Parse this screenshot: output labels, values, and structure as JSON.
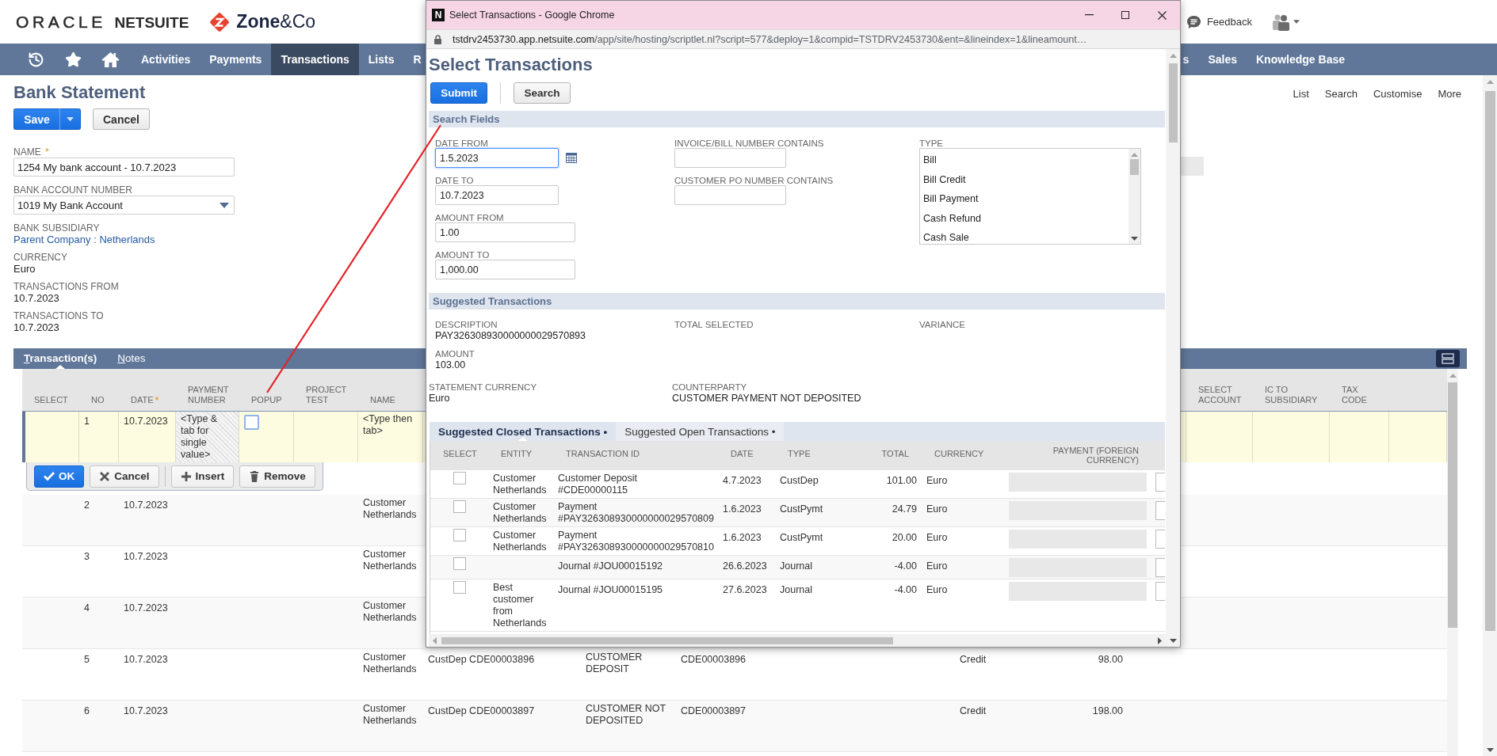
{
  "header": {
    "brand": "ORACLE **NETSUITE**",
    "partner": "**Zone**&Co",
    "feedback": "Feedback"
  },
  "nav": {
    "items": [
      {
        "label": "Activities",
        "selected": false
      },
      {
        "label": "Payments",
        "selected": false
      },
      {
        "label": "Transactions",
        "selected": true
      },
      {
        "label": "Lists",
        "selected": false
      },
      {
        "label": "R",
        "selected": false
      }
    ],
    "items_right": [
      {
        "label": "s",
        "selected": false
      },
      {
        "label": "Sales",
        "selected": false
      },
      {
        "label": "Knowledge Base",
        "selected": false
      }
    ]
  },
  "page": {
    "title": "Bank Statement",
    "actions": [
      "List",
      "Search",
      "Customise",
      "More"
    ],
    "save": "Save",
    "cancel": "Cancel"
  },
  "form": {
    "fields": [
      {
        "kind": "input",
        "label": "NAME",
        "mark": "*",
        "value": "1254 My bank account - 10.7.2023"
      },
      {
        "kind": "select",
        "label": "BANK ACCOUNT NUMBER",
        "value": "1019 My Bank Account"
      },
      {
        "kind": "link",
        "label": "BANK SUBSIDIARY",
        "value": "Parent Company : Netherlands"
      },
      {
        "kind": "text",
        "label": "CURRENCY",
        "value": "Euro"
      },
      {
        "kind": "text",
        "label": "TRANSACTIONS FROM",
        "value": "10.7.2023"
      },
      {
        "kind": "text",
        "label": "TRANSACTIONS TO",
        "value": "10.7.2023"
      }
    ],
    "side_field": {
      "disabled": true
    }
  },
  "tabs": [
    {
      "label": "Transaction(s)",
      "selected": true
    },
    {
      "label": "Notes",
      "selected": false
    }
  ],
  "table": {
    "columns": [
      {
        "label": "SELECT"
      },
      {
        "label": "NO"
      },
      {
        "label": "DATE",
        "mark": "*"
      },
      {
        "label": "PAYMENT NUMBER"
      },
      {
        "label": "POPUP"
      },
      {
        "label": "PROJECT TEST"
      },
      {
        "label": "NAME"
      }
    ],
    "columns_right": [
      {
        "label": "SELECT ACCOUNT"
      },
      {
        "label": "IC TO SUBSIDIARY"
      },
      {
        "label": "TAX CODE"
      }
    ],
    "edit_row": {
      "no": "1",
      "date": "10.7.2023",
      "payment_number": "<Type & tab for single value>",
      "popup": {
        "checked": false
      },
      "name": "<Type then tab>"
    },
    "edit_buttons": [
      {
        "kind": "ok",
        "label": "OK"
      },
      {
        "kind": "cancel",
        "label": "Cancel"
      },
      {
        "kind": "insert",
        "label": "Insert"
      },
      {
        "kind": "remove",
        "label": "Remove"
      }
    ],
    "rows": [
      {
        "no": "2",
        "date": "10.7.2023",
        "name": "Customer Netherlands"
      },
      {
        "no": "3",
        "date": "10.7.2023",
        "name": "Customer Netherlands"
      },
      {
        "no": "4",
        "date": "10.7.2023",
        "name": "Customer Netherlands"
      },
      {
        "no": "5",
        "date": "10.7.2023",
        "name": "Customer Netherlands",
        "column_8": "CustDep CDE00003896",
        "column_9": "CUSTOMER DEPOSIT",
        "column_10": "CDE00003896",
        "column_11": "Credit",
        "column_12": "98.00"
      },
      {
        "no": "6",
        "date": "10.7.2023",
        "name": "Customer Netherlands",
        "column_8": "CustDep CDE00003897",
        "column_9": "CUSTOMER NOT DEPOSITED",
        "column_10": "CDE00003897",
        "column_11": "Credit",
        "column_12": "198.00"
      }
    ]
  },
  "popup": {
    "app_icon": "N",
    "window_title": "Select Transactions - Google Chrome",
    "url_host": "tstdrv2453730.app.netsuite.com",
    "url_path": "/app/site/hosting/scriptlet.nl?script=577&deploy=1&compid=TSTDRV2453730&ent=&lineindex=1&lineamount…",
    "title": "Select Transactions",
    "buttons": [
      {
        "kind": "primary",
        "label": "Submit"
      },
      {
        "kind": "secondary",
        "label": "Search"
      }
    ],
    "search_section": "Search Fields",
    "search_fields": [
      {
        "kind": "date",
        "label": "DATE FROM",
        "value": "1.5.2023",
        "focused": true
      },
      {
        "kind": "date",
        "label": "DATE TO",
        "value": "10.7.2023",
        "focused": false
      },
      {
        "kind": "amount",
        "label": "AMOUNT FROM",
        "value": "1.00",
        "focused": false
      },
      {
        "kind": "amount",
        "label": "AMOUNT TO",
        "value": "1,000.00",
        "focused": false
      }
    ],
    "text_filters": [
      {
        "label": "INVOICE/BILL NUMBER CONTAINS",
        "focused": false
      },
      {
        "label": "CUSTOMER PO NUMBER CONTAINS",
        "focused": false
      }
    ],
    "type_filter": {
      "label": "TYPE",
      "options": [
        {
          "label": "Bill",
          "selected": false
        },
        {
          "label": "Bill Credit",
          "selected": false
        },
        {
          "label": "Bill Payment",
          "selected": false
        },
        {
          "label": "Cash Refund",
          "selected": false
        },
        {
          "label": "Cash Sale",
          "selected": false
        }
      ]
    },
    "suggested_section": "Suggested Transactions",
    "details": [
      {
        "label": "DESCRIPTION",
        "value": "PAY326308930000000029570893"
      },
      {
        "label": "TOTAL SELECTED"
      },
      {
        "label": "VARIANCE"
      },
      {
        "label": "AMOUNT",
        "value": "103.00"
      }
    ],
    "details_2": [
      {
        "label": "STATEMENT CURRENCY",
        "value": "Euro"
      },
      {
        "label": "COUNTERPARTY",
        "value": "CUSTOMER PAYMENT NOT DEPOSITED"
      }
    ],
    "subtabs": [
      {
        "label": "Suggested Closed Transactions •",
        "selected": true
      },
      {
        "label": "Suggested Open Transactions •",
        "selected": false
      }
    ],
    "columns": [
      "SELECT",
      "ENTITY",
      "TRANSACTION ID",
      "DATE",
      "TYPE",
      "TOTAL",
      "CURRENCY",
      "PAYMENT (FOREIGN CURRENCY)"
    ],
    "rows": [
      {
        "checked": false,
        "entity": "Customer Netherlands",
        "transaction_id": "Customer Deposit #CDE00000115",
        "date": "4.7.2023",
        "type": "CustDep",
        "total": "101.00",
        "currency": "Euro",
        "payment_disabled": true
      },
      {
        "checked": false,
        "entity": "Customer Netherlands",
        "transaction_id": "Payment #PAY326308930000000029570809",
        "date": "1.6.2023",
        "type": "CustPymt",
        "total": "24.79",
        "currency": "Euro",
        "payment_disabled": true
      },
      {
        "checked": false,
        "entity": "Customer Netherlands",
        "transaction_id": "Payment #PAY326308930000000029570810",
        "date": "1.6.2023",
        "type": "CustPymt",
        "total": "20.00",
        "currency": "Euro",
        "payment_disabled": true
      },
      {
        "checked": false,
        "transaction_id": "Journal #JOU00015192",
        "date": "26.6.2023",
        "type": "Journal",
        "total": "-4.00",
        "currency": "Euro",
        "payment_disabled": true
      },
      {
        "checked": false,
        "entity": "Best customer from Netherlands",
        "transaction_id": "Journal #JOU00015195",
        "date": "27.6.2023",
        "type": "Journal",
        "total": "-4.00",
        "currency": "Euro",
        "payment_disabled": true
      }
    ]
  }
}
